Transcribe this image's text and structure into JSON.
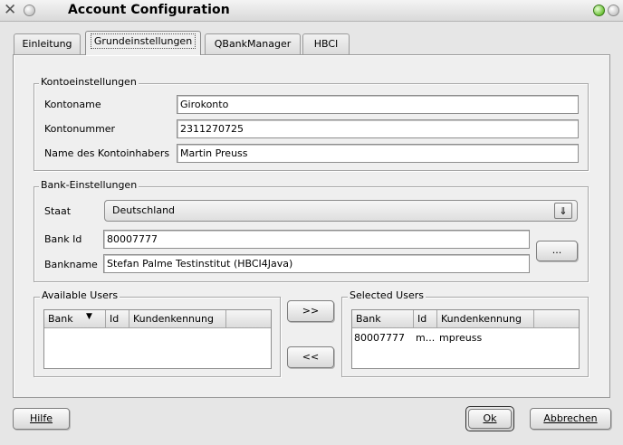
{
  "window": {
    "title": "Account Configuration"
  },
  "tabs": [
    {
      "label": "Einleitung"
    },
    {
      "label": "Grundeinstellungen"
    },
    {
      "label": "QBankManager"
    },
    {
      "label": "HBCI"
    }
  ],
  "konto": {
    "legend": "Kontoeinstellungen",
    "name_label": "Kontoname",
    "name_value": "Girokonto",
    "nummer_label": "Kontonummer",
    "nummer_value": "2311270725",
    "inhaber_label": "Name des Kontoinhabers",
    "inhaber_value": "Martin Preuss"
  },
  "bank": {
    "legend": "Bank-Einstellungen",
    "staat_label": "Staat",
    "staat_value": "Deutschland",
    "bankid_label": "Bank Id",
    "bankid_value": "80007777",
    "bankname_label": "Bankname",
    "bankname_value": "Stefan Palme Testinstitut (HBCI4Java)",
    "browse_label": "..."
  },
  "available": {
    "legend": "Available Users",
    "columns": [
      "Bank",
      "Id",
      "Kundenkennung"
    ],
    "sort_icon": "sort-descending-icon"
  },
  "selected": {
    "legend": "Selected Users",
    "columns": [
      "Bank",
      "Id",
      "Kundenkennung"
    ],
    "rows": [
      {
        "bank": "80007777",
        "id": "m...",
        "kunde": "mpreuss"
      }
    ]
  },
  "transfer": {
    "add_label": ">>",
    "remove_label": "<<"
  },
  "footer": {
    "help_label": "Hilfe",
    "ok_label": "Ok",
    "cancel_label": "Abbrechen"
  }
}
